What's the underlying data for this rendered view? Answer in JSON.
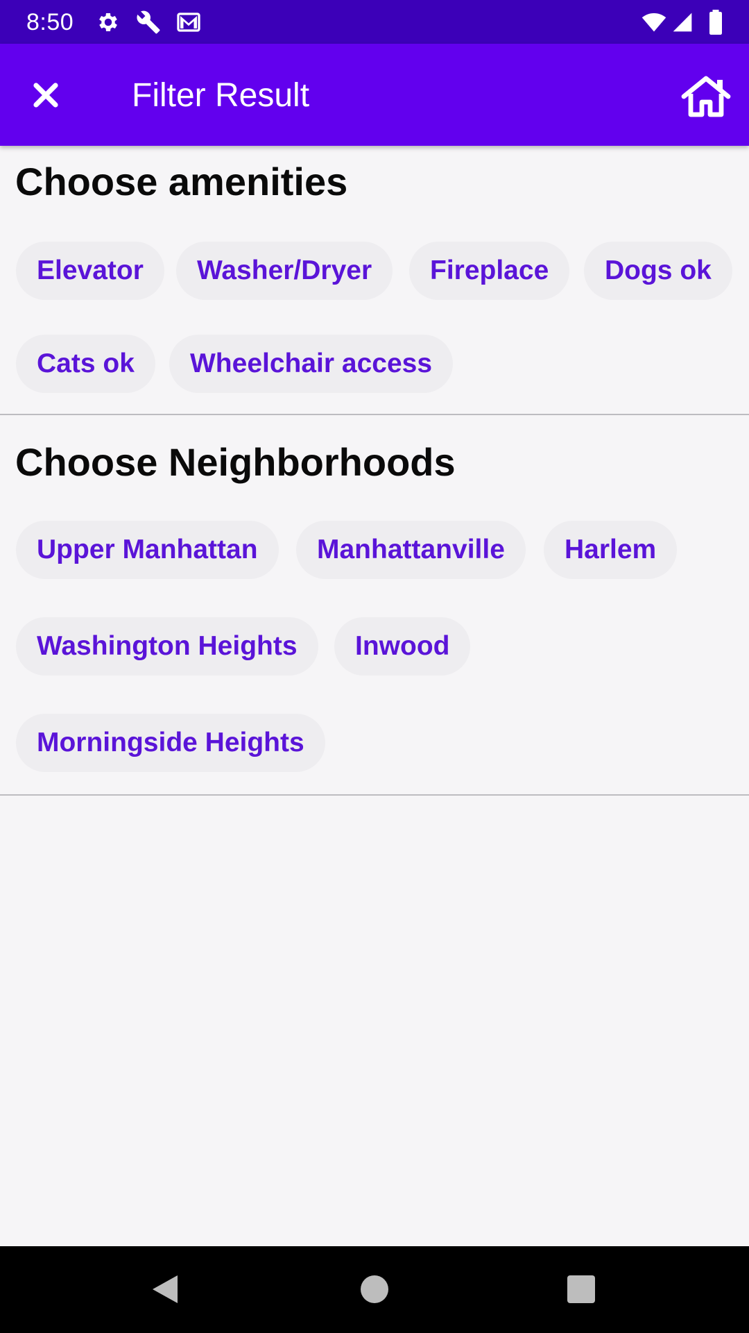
{
  "status_bar": {
    "time": "8:50",
    "icons": [
      "settings-gear-icon",
      "wrench-icon",
      "gmail-icon",
      "wifi-icon",
      "cell-signal-icon",
      "battery-icon"
    ]
  },
  "app_bar": {
    "title": "Filter Result",
    "close_icon": "close-icon",
    "home_icon": "home-icon",
    "color": "#6200ee"
  },
  "amenities": {
    "heading": "Choose amenities",
    "chips": [
      "Elevator",
      "Washer/Dryer",
      "Fireplace",
      "Dogs ok",
      "Cats ok",
      "Wheelchair access"
    ]
  },
  "neighborhoods": {
    "heading": "Choose Neighborhoods",
    "chips": [
      "Upper Manhattan",
      "Manhattanville",
      "Harlem",
      "Washington Heights",
      "Inwood",
      "Morningside Heights"
    ]
  },
  "colors": {
    "accent": "#5a14d8",
    "status_bar": "#3c00b8",
    "chip_background": "#eeedf0"
  },
  "nav_bar": {
    "icons": [
      "back-icon",
      "home-circle-icon",
      "recents-icon"
    ]
  }
}
